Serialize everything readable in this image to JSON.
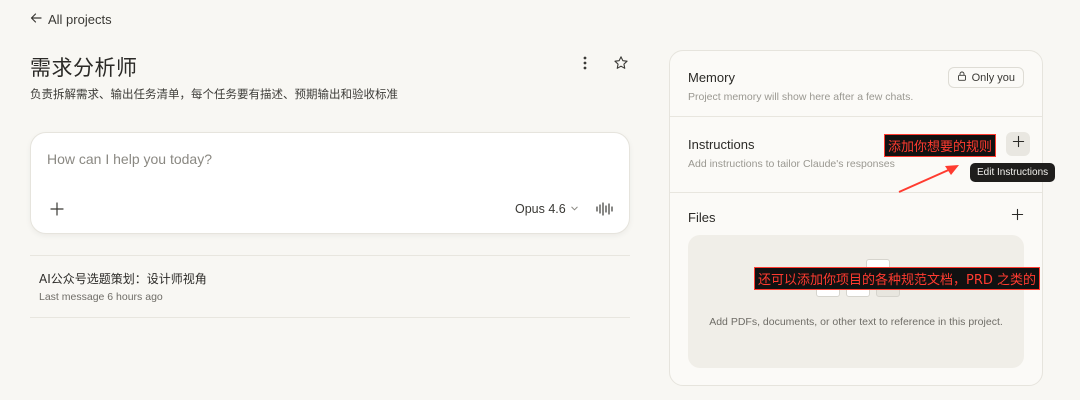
{
  "nav": {
    "back_label": "All projects"
  },
  "project": {
    "title": "需求分析师",
    "description": "负责拆解需求、输出任务清单，每个任务要有描述、预期输出和验收标准"
  },
  "chat_input": {
    "placeholder": "How can I help you today?",
    "model": "Opus 4.6"
  },
  "conversations": [
    {
      "title": "AI公众号选题策划：设计师视角",
      "meta": "Last message 6 hours ago"
    }
  ],
  "panel": {
    "memory": {
      "title": "Memory",
      "subtitle": "Project memory will show here after a few chats.",
      "visibility": "Only you"
    },
    "instructions": {
      "title": "Instructions",
      "subtitle": "Add instructions to tailor Claude's responses",
      "tooltip": "Edit Instructions"
    },
    "files": {
      "title": "Files",
      "empty_text": "Add PDFs, documents, or other text to reference in this project."
    }
  },
  "annotations": {
    "instructions_note": "添加你想要的规则",
    "files_note": "还可以添加你项目的各种规范文档，PRD 之类的"
  },
  "colors": {
    "background": "#f8f7f3",
    "annotation_red": "#ff3b30",
    "tooltip_bg": "#1f1e1c"
  }
}
